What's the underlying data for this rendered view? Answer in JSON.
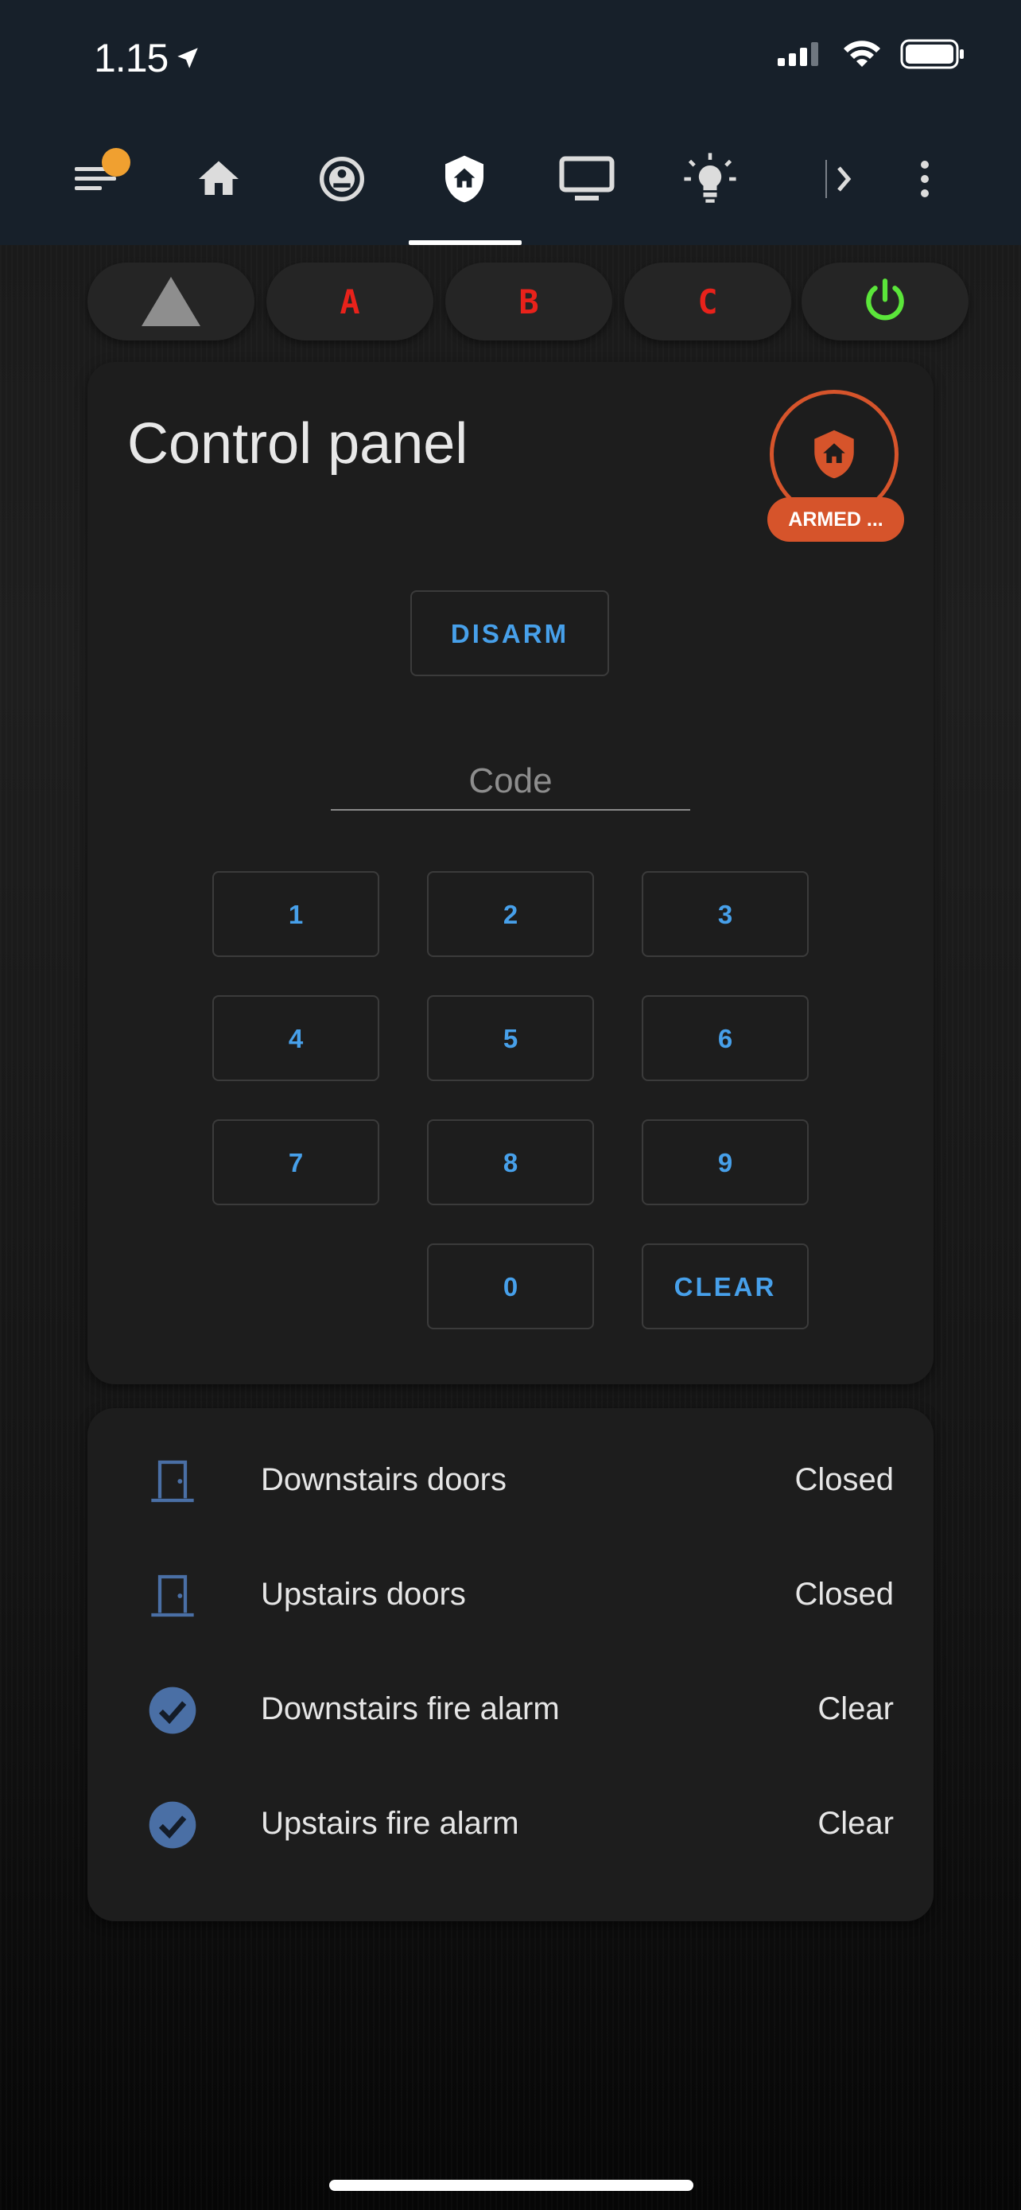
{
  "status_bar": {
    "time": "1.15",
    "icons": [
      "location-arrow-icon",
      "cellular-signal-icon",
      "wifi-icon",
      "battery-icon"
    ]
  },
  "nav": {
    "tabs": [
      {
        "name": "menu",
        "icon": "menu-icon",
        "badge": true
      },
      {
        "name": "home",
        "icon": "home-icon"
      },
      {
        "name": "vacuum",
        "icon": "robot-vacuum-icon"
      },
      {
        "name": "security",
        "icon": "shield-home-icon",
        "active": true
      },
      {
        "name": "media",
        "icon": "monitor-icon"
      },
      {
        "name": "lights",
        "icon": "lightbulb-icon"
      }
    ],
    "more": "chevron-right-icon",
    "overflow": "more-vertical-icon"
  },
  "mode_chips": [
    {
      "label": "",
      "icon": "triangle-icon"
    },
    {
      "label": "A"
    },
    {
      "label": "B"
    },
    {
      "label": "C"
    },
    {
      "label": "",
      "icon": "power-icon"
    }
  ],
  "alarm_panel": {
    "title": "Control panel",
    "state_badge": "ARMED ...",
    "disarm_label": "DISARM",
    "code_placeholder": "Code",
    "keys": [
      "1",
      "2",
      "3",
      "4",
      "5",
      "6",
      "7",
      "8",
      "9",
      "0"
    ],
    "clear_label": "CLEAR"
  },
  "sensors": [
    {
      "name": "Downstairs doors",
      "state": "Closed",
      "icon": "door-closed-icon"
    },
    {
      "name": "Upstairs doors",
      "state": "Closed",
      "icon": "door-closed-icon"
    },
    {
      "name": "Downstairs fire alarm",
      "state": "Clear",
      "icon": "check-circle-icon"
    },
    {
      "name": "Upstairs fire alarm",
      "state": "Clear",
      "icon": "check-circle-icon"
    }
  ],
  "colors": {
    "topbar": "#17202a",
    "accent_blue": "#47a0ea",
    "armed_orange": "#d6542b",
    "chip_red": "#e8221b",
    "power_green": "#5be63a",
    "sensor_icon_blue": "#4a6fa5",
    "badge_orange": "#f0a030"
  }
}
